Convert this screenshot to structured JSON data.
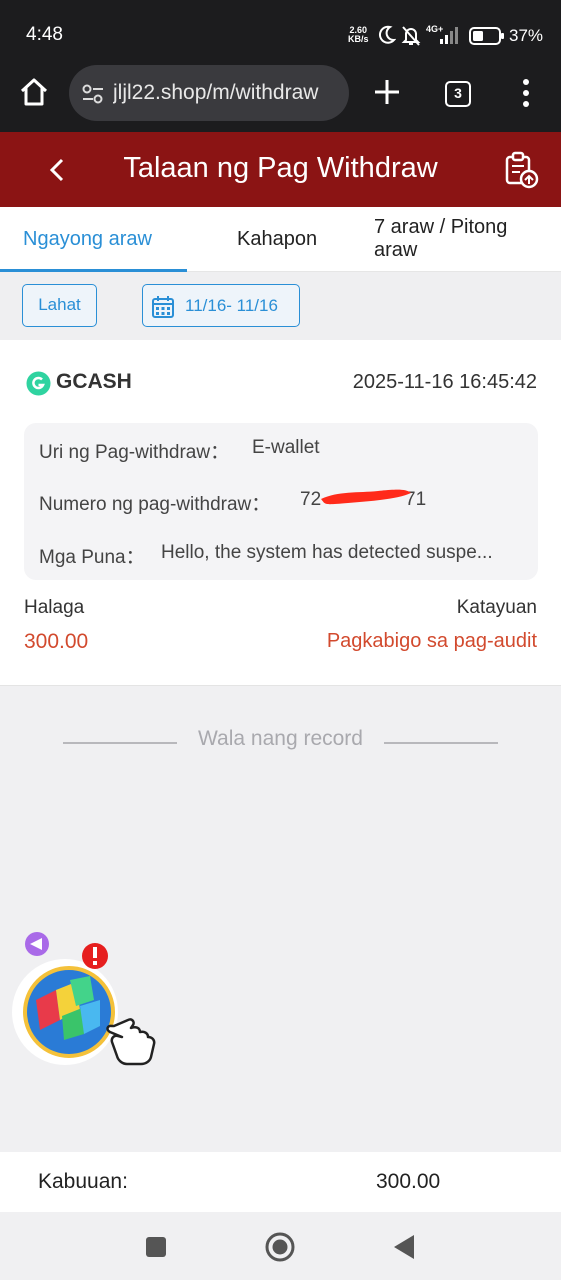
{
  "status_bar": {
    "time": "4:48",
    "speed_value": "2.60",
    "speed_unit": "KB/s",
    "network": "4G+",
    "battery": "37%"
  },
  "browser": {
    "url": "jljl22.shop/m/withdraw",
    "tab_count": "3"
  },
  "header": {
    "title": "Talaan ng Pag Withdraw"
  },
  "tabs": [
    {
      "label": "Ngayong araw",
      "active": true
    },
    {
      "label": "Kahapon",
      "active": false
    },
    {
      "label": "7 araw / Pitong araw",
      "active": false
    }
  ],
  "filters": {
    "all_label": "Lahat",
    "date_range": "11/16- 11/16"
  },
  "record": {
    "method": "GCASH",
    "datetime": "2025-11-16 16:45:42",
    "type_label": "Uri ng Pag-withdraw：",
    "type_value": "E-wallet",
    "number_label": "Numero ng pag-withdraw：",
    "number_prefix": "72",
    "number_suffix": "71",
    "remarks_label": "Mga Puna：",
    "remarks_value": "Hello, the system has detected suspe...",
    "amount_label": "Halaga",
    "amount_value": "300.00",
    "status_label": "Katayuan",
    "status_value": "Pagkabigo sa pag-audit"
  },
  "empty_state": "Wala nang record",
  "total": {
    "label": "Kabuuan:",
    "value": "300.00"
  },
  "colors": {
    "header_bg": "#8b1414",
    "accent": "#2a8fd6",
    "error": "#d24a2e"
  }
}
